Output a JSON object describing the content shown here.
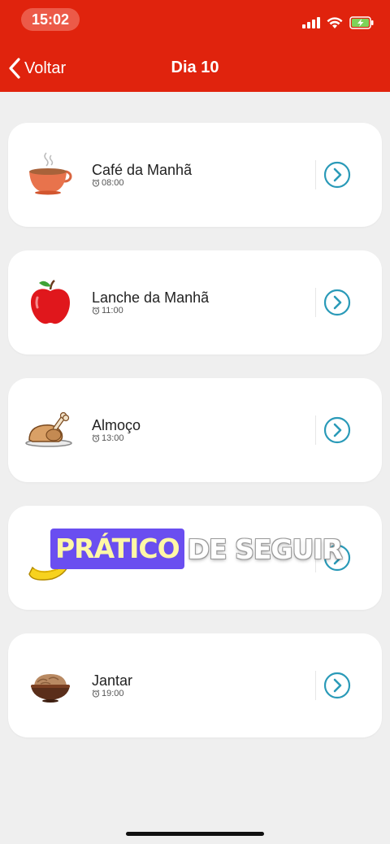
{
  "status": {
    "time": "15:02"
  },
  "header": {
    "back_label": "Voltar",
    "title": "Dia 10"
  },
  "meals": [
    {
      "name": "Café da Manhã",
      "time": "08:00",
      "icon": "coffee-cup-icon"
    },
    {
      "name": "Lanche da Manhã",
      "time": "11:00",
      "icon": "apple-icon"
    },
    {
      "name": "Almoço",
      "time": "13:00",
      "icon": "roast-chicken-icon"
    },
    {
      "name": "",
      "time": "",
      "icon": "banana-icon"
    },
    {
      "name": "Jantar",
      "time": "19:00",
      "icon": "bowl-icon"
    }
  ],
  "overlay": {
    "highlight": "PRÁTICO",
    "rest": "DE SEGUIR"
  },
  "colors": {
    "header": "#e0230d",
    "accent": "#2a9ab8",
    "overlay_bg": "#6a4ef0",
    "overlay_text": "#fff7a6"
  }
}
